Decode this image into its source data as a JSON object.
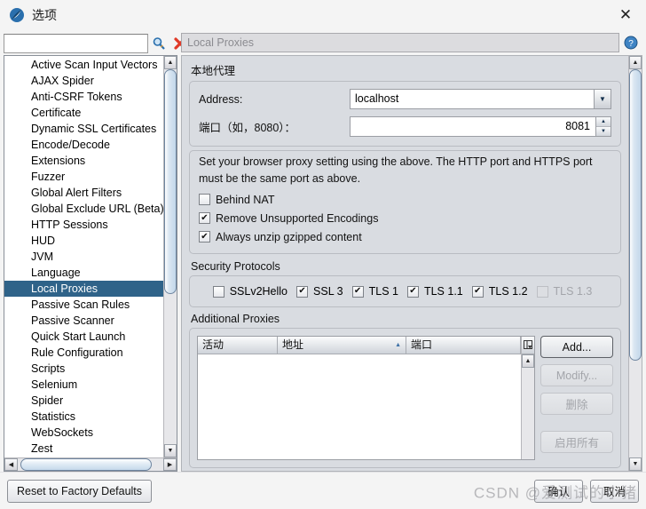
{
  "window": {
    "title": "选项",
    "icon": "zap-logo-icon",
    "close_label": "✕"
  },
  "sidebar": {
    "search": {
      "value": "",
      "placeholder": ""
    },
    "search_icon": "search-icon",
    "clear_icon": "clear-x-icon",
    "items": [
      {
        "label": "Active Scan Input Vectors",
        "selected": false
      },
      {
        "label": "AJAX Spider",
        "selected": false
      },
      {
        "label": "Anti-CSRF Tokens",
        "selected": false
      },
      {
        "label": "Certificate",
        "selected": false
      },
      {
        "label": "Dynamic SSL Certificates",
        "selected": false
      },
      {
        "label": "Encode/Decode",
        "selected": false
      },
      {
        "label": "Extensions",
        "selected": false
      },
      {
        "label": "Fuzzer",
        "selected": false
      },
      {
        "label": "Global Alert Filters",
        "selected": false
      },
      {
        "label": "Global Exclude URL (Beta)",
        "selected": false
      },
      {
        "label": "HTTP Sessions",
        "selected": false
      },
      {
        "label": "HUD",
        "selected": false
      },
      {
        "label": "JVM",
        "selected": false
      },
      {
        "label": "Language",
        "selected": false
      },
      {
        "label": "Local Proxies",
        "selected": true
      },
      {
        "label": "Passive Scan Rules",
        "selected": false
      },
      {
        "label": "Passive Scanner",
        "selected": false
      },
      {
        "label": "Quick Start Launch",
        "selected": false
      },
      {
        "label": "Rule Configuration",
        "selected": false
      },
      {
        "label": "Scripts",
        "selected": false
      },
      {
        "label": "Selenium",
        "selected": false
      },
      {
        "label": "Spider",
        "selected": false
      },
      {
        "label": "Statistics",
        "selected": false
      },
      {
        "label": "WebSockets",
        "selected": false
      },
      {
        "label": "Zest",
        "selected": false
      }
    ],
    "selected_color": "#2f6389"
  },
  "panel": {
    "title": "Local Proxies",
    "help_icon": "help-circle-icon",
    "local_proxy": {
      "section_label": "本地代理",
      "address_label": "Address:",
      "address_value": "localhost",
      "port_label": "端口（如，8080）：",
      "port_value": "8081",
      "note_line1": "Set your browser proxy setting using the above.  The HTTP port and HTTPS port",
      "note_line2": "must be the same port as above.",
      "checkboxes": [
        {
          "label": "Behind NAT",
          "checked": false,
          "disabled": false
        },
        {
          "label": "Remove Unsupported Encodings",
          "checked": true,
          "disabled": false
        },
        {
          "label": "Always unzip gzipped content",
          "checked": true,
          "disabled": false
        }
      ]
    },
    "security_protocols": {
      "section_label": "Security Protocols",
      "items": [
        {
          "label": "SSLv2Hello",
          "checked": false,
          "disabled": false
        },
        {
          "label": "SSL 3",
          "checked": true,
          "disabled": false
        },
        {
          "label": "TLS 1",
          "checked": true,
          "disabled": false
        },
        {
          "label": "TLS 1.1",
          "checked": true,
          "disabled": false
        },
        {
          "label": "TLS 1.2",
          "checked": true,
          "disabled": false
        },
        {
          "label": "TLS 1.3",
          "checked": false,
          "disabled": true
        }
      ]
    },
    "additional_proxies": {
      "section_label": "Additional Proxies",
      "columns": [
        {
          "label": "活动",
          "sorted": false
        },
        {
          "label": "地址",
          "sorted": true,
          "sort_dir": "asc"
        },
        {
          "label": "端口",
          "sorted": false
        }
      ],
      "rows": [],
      "column_control_icon": "column-settings-icon",
      "buttons": [
        {
          "label": "Add...",
          "disabled": false
        },
        {
          "label": "Modify...",
          "disabled": true
        },
        {
          "label": "删除",
          "disabled": true
        },
        {
          "label": "启用所有",
          "disabled": true
        }
      ]
    }
  },
  "footer": {
    "reset_label": "Reset to Factory Defaults",
    "confirm_label": "确认",
    "cancel_label": "取消",
    "watermark": "CSDN @爱测试的小猪"
  }
}
